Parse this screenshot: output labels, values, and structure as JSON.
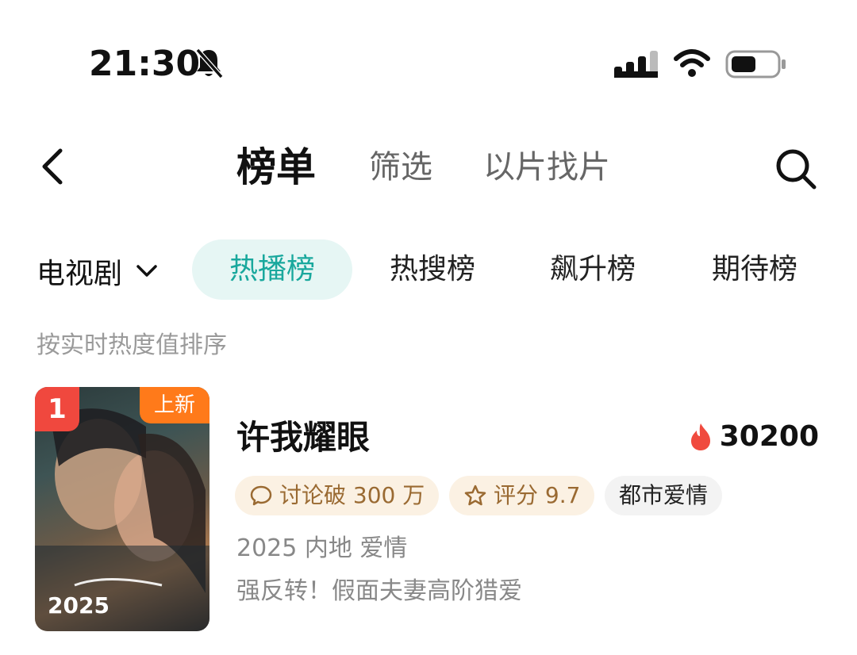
{
  "status_bar": {
    "time": "21:30",
    "icons": [
      "bell-muted-icon",
      "signal-icon",
      "wifi-icon",
      "battery-icon"
    ]
  },
  "nav": {
    "tabs": [
      "榜单",
      "筛选",
      "以片找片"
    ],
    "active_tab": "榜单",
    "icons": [
      "back-arrow-icon",
      "search-icon"
    ]
  },
  "category": {
    "select_label": "电视剧",
    "pills": [
      "热播榜",
      "热搜榜",
      "飙升榜",
      "期待榜"
    ],
    "active_pill": "热播榜"
  },
  "sort_hint": "按实时热度值排序",
  "items": [
    {
      "rank": "1",
      "badge": "上新",
      "poster_year": "2025",
      "title": "许我耀眼",
      "heat": "30200",
      "tags": [
        "讨论破 300 万",
        "评分 9.7",
        "都市爱情"
      ],
      "meta": "2025 内地 爱情",
      "tagline": "强反转！假面夫妻高阶猎爱"
    }
  ],
  "colors": {
    "accent": "#19a89d",
    "accent_bg": "#e6f6f4",
    "rank_red": "#f0483e",
    "new_orange": "#ff7a1a",
    "tag_gold_bg": "#fbf1e3",
    "tag_gold_text": "#9a6a32"
  }
}
